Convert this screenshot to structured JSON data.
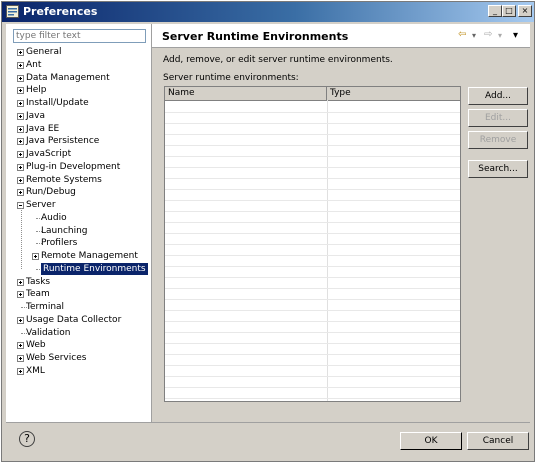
{
  "window": {
    "title": "Preferences",
    "min": "_",
    "max": "□",
    "close": "×"
  },
  "filter": {
    "placeholder": "type filter text"
  },
  "tree": [
    {
      "label": "General",
      "expander": "plus"
    },
    {
      "label": "Ant",
      "expander": "plus"
    },
    {
      "label": "Data Management",
      "expander": "plus"
    },
    {
      "label": "Help",
      "expander": "plus"
    },
    {
      "label": "Install/Update",
      "expander": "plus"
    },
    {
      "label": "Java",
      "expander": "plus"
    },
    {
      "label": "Java EE",
      "expander": "plus"
    },
    {
      "label": "Java Persistence",
      "expander": "plus"
    },
    {
      "label": "JavaScript",
      "expander": "plus"
    },
    {
      "label": "Plug-in Development",
      "expander": "plus"
    },
    {
      "label": "Remote Systems",
      "expander": "plus"
    },
    {
      "label": "Run/Debug",
      "expander": "plus"
    },
    {
      "label": "Server",
      "expander": "minus"
    },
    {
      "label": "Audio",
      "child": true
    },
    {
      "label": "Launching",
      "child": true
    },
    {
      "label": "Profilers",
      "child": true
    },
    {
      "label": "Remote Management",
      "child": true,
      "expander": "plus"
    },
    {
      "label": "Runtime Environments",
      "child": true,
      "selected": true
    },
    {
      "label": "Tasks",
      "expander": "plus"
    },
    {
      "label": "Team",
      "expander": "plus"
    },
    {
      "label": "Terminal"
    },
    {
      "label": "Usage Data Collector",
      "expander": "plus"
    },
    {
      "label": "Validation"
    },
    {
      "label": "Web",
      "expander": "plus"
    },
    {
      "label": "Web Services",
      "expander": "plus"
    },
    {
      "label": "XML",
      "expander": "plus"
    }
  ],
  "page": {
    "title": "Server Runtime Environments",
    "description": "Add, remove, or edit server runtime environments.",
    "list_label": "Server runtime environments:",
    "columns": [
      "Name",
      "Type"
    ],
    "nav": {
      "back": "⇦",
      "forward": "⇨",
      "menu": "▾"
    }
  },
  "buttons": {
    "add": "Add...",
    "edit": "Edit...",
    "remove": "Remove",
    "search": "Search..."
  },
  "footer": {
    "help": "?",
    "ok": "OK",
    "cancel": "Cancel"
  }
}
